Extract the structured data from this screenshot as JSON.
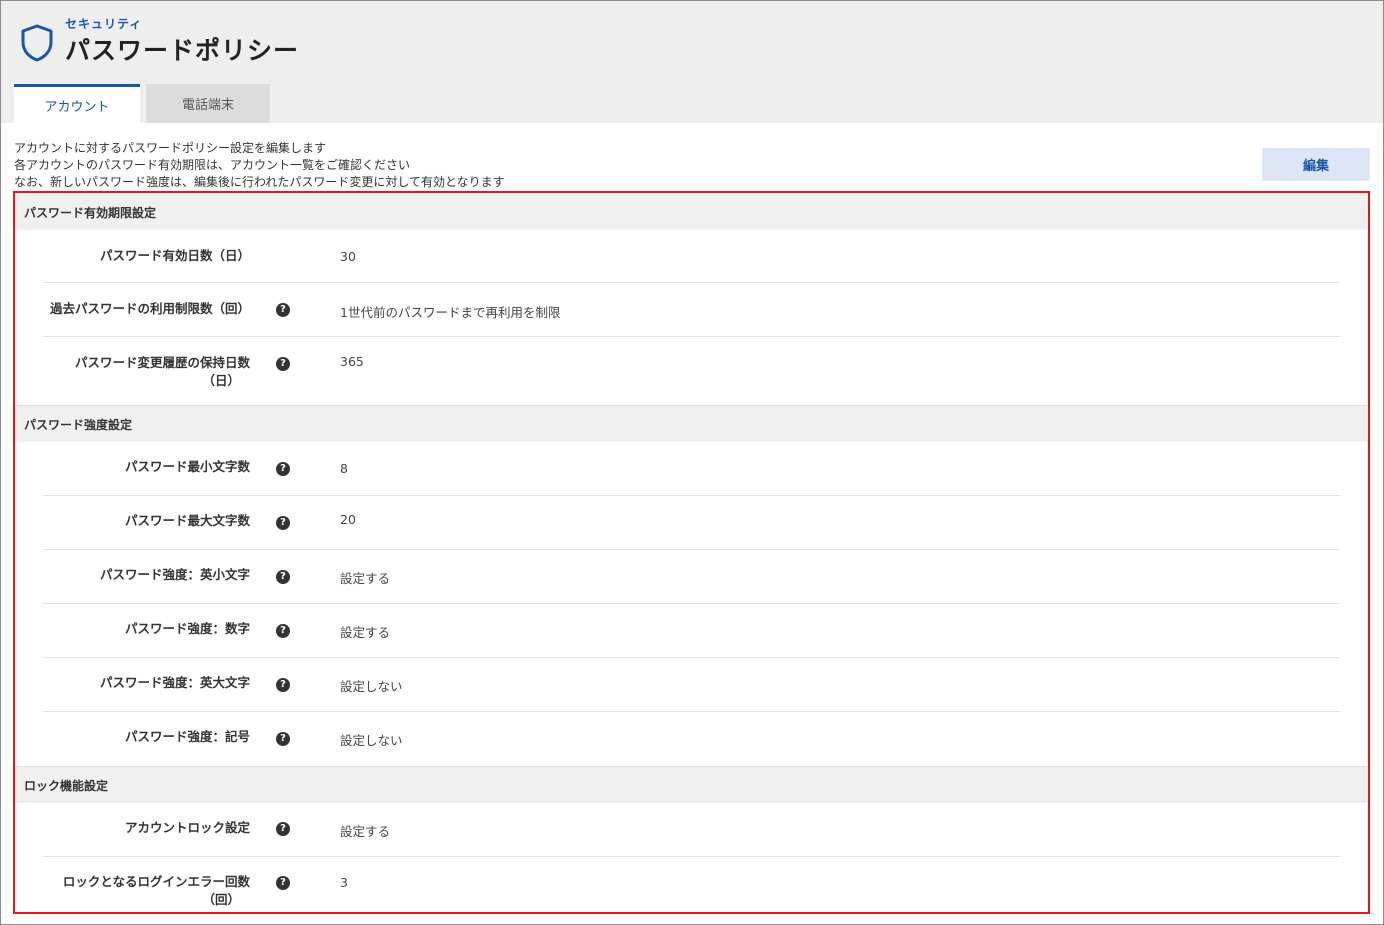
{
  "header": {
    "breadcrumb": "セキュリティ",
    "title": "パスワードポリシー",
    "icon": "shield-icon",
    "accent_color": "#1a56a8"
  },
  "tabs": [
    {
      "label": "アカウント",
      "active": true
    },
    {
      "label": "電話端末",
      "active": false
    }
  ],
  "description": [
    "アカウントに対するパスワードポリシー設定を編集します",
    "各アカウントのパスワード有効期限は、アカウント一覧をご確認ください",
    "なお、新しいパスワード強度は、編集後に行われたパスワード変更に対して有効となります"
  ],
  "edit_button": "編集",
  "sections": [
    {
      "title": "パスワード有効期限設定",
      "rows": [
        {
          "label": "パスワード有効日数（日）",
          "value": "30",
          "help": false
        },
        {
          "label": "過去パスワードの利用制限数（回）",
          "value": "1世代前のパスワードまで再利用を制限",
          "help": true
        },
        {
          "label_lines": [
            "パスワード変更履歴の保持日数",
            "（日）"
          ],
          "value": "365",
          "help": true
        }
      ]
    },
    {
      "title": "パスワード強度設定",
      "rows": [
        {
          "label": "パスワード最小文字数",
          "value": "8",
          "help": true
        },
        {
          "label": "パスワード最大文字数",
          "value": "20",
          "help": true
        },
        {
          "label": "パスワード強度：英小文字",
          "value": "設定する",
          "help": true
        },
        {
          "label": "パスワード強度：数字",
          "value": "設定する",
          "help": true
        },
        {
          "label": "パスワード強度：英大文字",
          "value": "設定しない",
          "help": true
        },
        {
          "label": "パスワード強度：記号",
          "value": "設定しない",
          "help": true
        }
      ]
    },
    {
      "title": "ロック機能設定",
      "rows": [
        {
          "label": "アカウントロック設定",
          "value": "設定する",
          "help": true
        },
        {
          "label_lines": [
            "ロックとなるログインエラー回数",
            "（回）"
          ],
          "value": "3",
          "help": true
        }
      ]
    }
  ],
  "help_glyph": "?"
}
